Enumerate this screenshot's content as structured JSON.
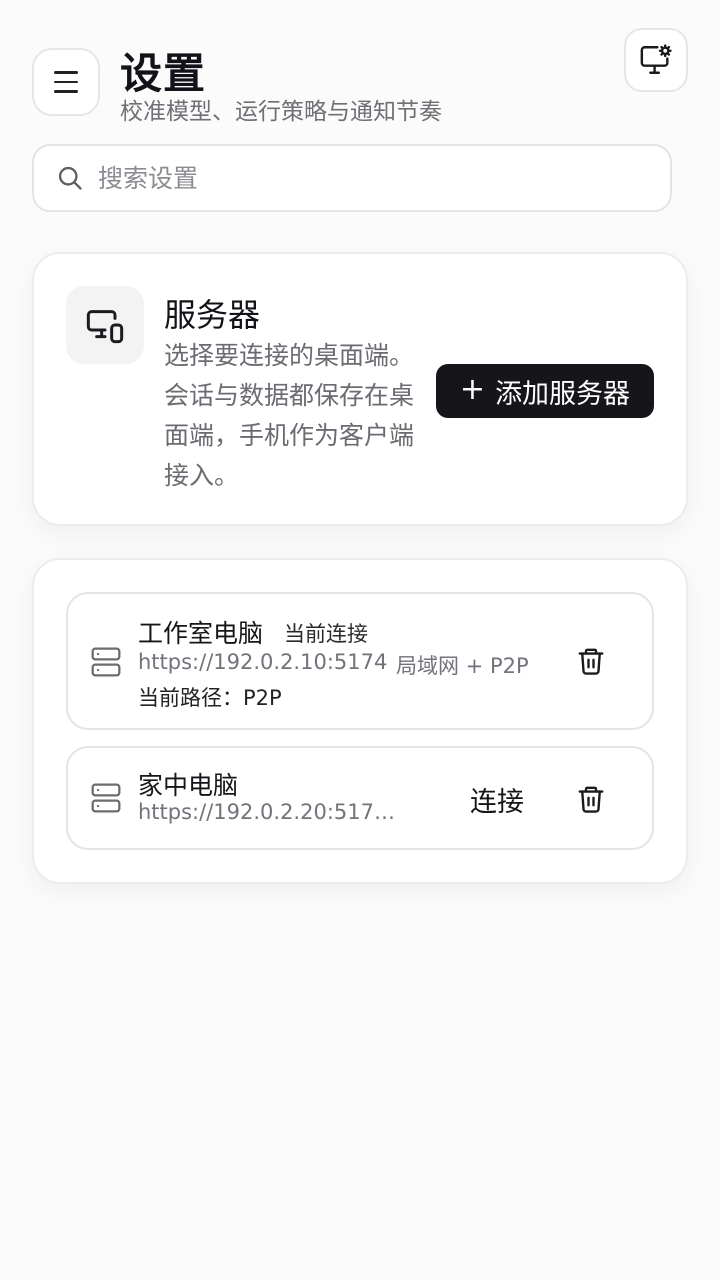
{
  "header": {
    "title": "设置",
    "subtitle": "校准模型、运行策略与通知节奏"
  },
  "search": {
    "placeholder": "搜索设置"
  },
  "server_section": {
    "title": "服务器",
    "description": "选择要连接的桌面端。会话与数据都保存在桌面端，手机作为客户端接入。",
    "add_button_label": "添加服务器"
  },
  "servers": [
    {
      "name": "工作室电脑",
      "badge": "当前连接",
      "url": "https://192.0.2.10:5174",
      "mode": "局域网 + P2P",
      "path": "当前路径：P2P"
    },
    {
      "name": "家中电脑",
      "url": "https://192.0.2.20:5174...",
      "connect_label": "连接"
    }
  ],
  "icons": {
    "menu": "menu-icon",
    "monitor_settings": "monitor-gear-icon",
    "search": "search-icon",
    "devices": "devices-icon",
    "server": "server-icon",
    "delete": "trash-icon"
  }
}
